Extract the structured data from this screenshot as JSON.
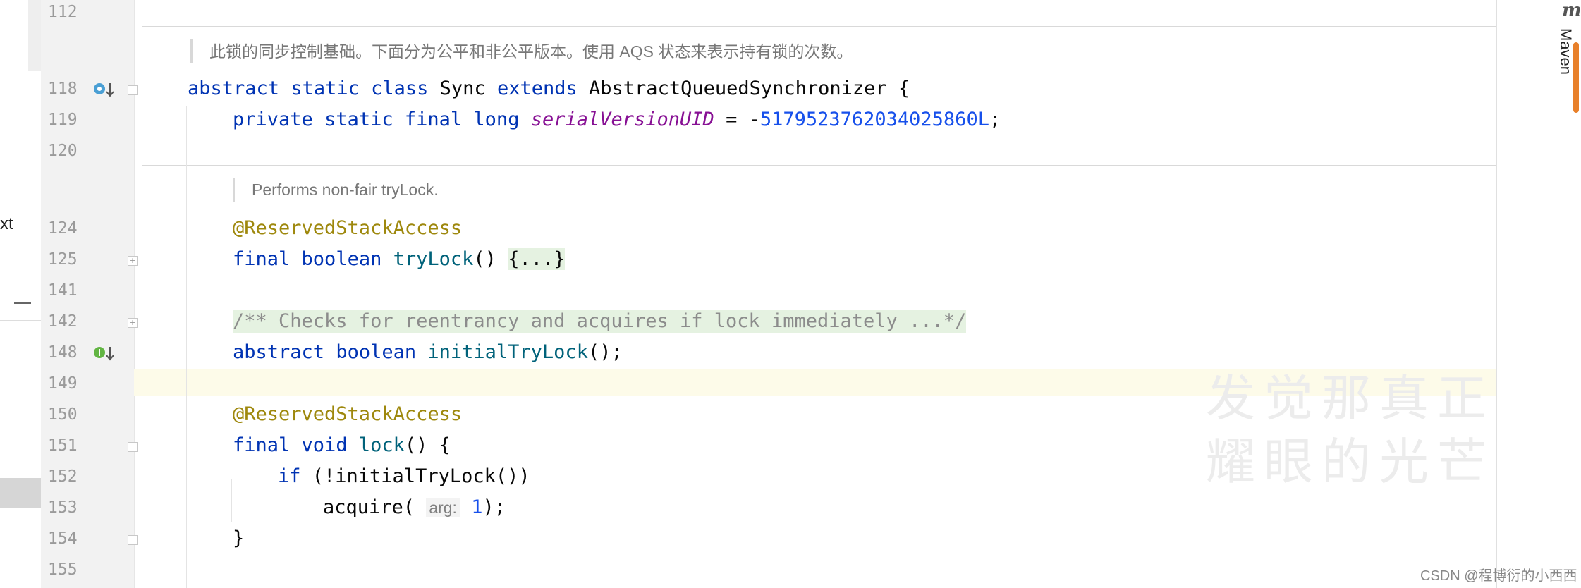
{
  "left_panel": {
    "cut_text": "xt"
  },
  "gutter": {
    "lines": [
      "112",
      "118",
      "119",
      "120",
      "124",
      "125",
      "141",
      "142",
      "148",
      "149",
      "150",
      "151",
      "152",
      "153",
      "154",
      "155"
    ],
    "icons": [
      "override-down-icon",
      "implemented-down-icon"
    ]
  },
  "doc_comments": {
    "sync_class": "此锁的同步控制基础。下面分为公平和非公平版本。使用 AQS 状态来表示持有锁的次数。",
    "try_lock": "Performs non-fair tryLock."
  },
  "code": {
    "l118": {
      "abstract": "abstract",
      "static": "static",
      "class": "class",
      "name": "Sync",
      "extends": "extends",
      "super": "AbstractQueuedSynchronizer",
      "brace": "{"
    },
    "l119": {
      "private": "private",
      "static": "static",
      "final": "final",
      "long": "long",
      "field": "serialVersionUID",
      "eq": " = -",
      "value": "5179523762034025860L",
      "semi": ";"
    },
    "l124": {
      "annotation": "@ReservedStackAccess"
    },
    "l125": {
      "final": "final",
      "boolean": "boolean",
      "method": "tryLock",
      "parens": "() ",
      "folded": "{...}"
    },
    "l142": {
      "comment": "/** Checks for reentrancy and acquires if lock immediately ...*/"
    },
    "l148": {
      "abstract": "abstract",
      "boolean": "boolean",
      "method": "initialTryLock",
      "rest": "();"
    },
    "l150": {
      "annotation": "@ReservedStackAccess"
    },
    "l151": {
      "final": "final",
      "void": "void",
      "method": "lock",
      "rest": "() {"
    },
    "l152": {
      "if": "if",
      "rest": " (!initialTryLock())"
    },
    "l153": {
      "call": "acquire(",
      "hint": "arg:",
      "arg": "1",
      "rest": ");"
    },
    "l154": {
      "brace": "}"
    }
  },
  "watermark": {
    "line1": "发觉那真正",
    "line2": "耀眼的光芒"
  },
  "right_bar": {
    "maven_icon": "m",
    "maven_label": "Maven"
  },
  "credit": "CSDN @程博衍的小西西"
}
